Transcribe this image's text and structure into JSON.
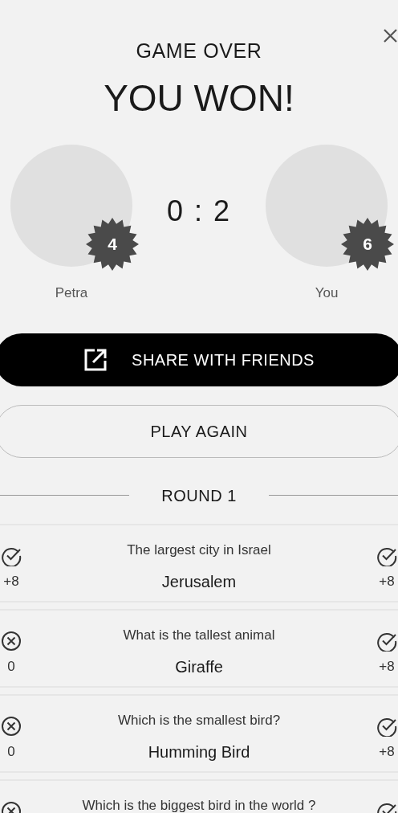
{
  "header": {
    "subtitle": "GAME OVER",
    "title": "YOU WON!"
  },
  "players": [
    {
      "name": "Petra",
      "badge": "4"
    },
    {
      "name": "You",
      "badge": "6"
    }
  ],
  "score": "0 : 2",
  "buttons": [
    {
      "label": "SHARE WITH FRIENDS",
      "kind": "primary"
    },
    {
      "label": "PLAY AGAIN",
      "kind": "outline"
    }
  ],
  "round": {
    "title": "ROUND 1"
  },
  "questions": [
    {
      "question": "The largest city in Israel",
      "answer": "Jerusalem",
      "left": {
        "correct": true,
        "points": "+8"
      },
      "right": {
        "correct": true,
        "points": "+8"
      }
    },
    {
      "question": "What is the tallest animal",
      "answer": "Giraffe",
      "left": {
        "correct": false,
        "points": "0"
      },
      "right": {
        "correct": true,
        "points": "+8"
      }
    },
    {
      "question": "Which is the smallest bird?",
      "answer": "Humming Bird",
      "left": {
        "correct": false,
        "points": "0"
      },
      "right": {
        "correct": true,
        "points": "+8"
      }
    },
    {
      "question": "Which is the biggest bird in the world ?",
      "left": {
        "correct": false
      },
      "right": {
        "correct": true
      }
    }
  ]
}
